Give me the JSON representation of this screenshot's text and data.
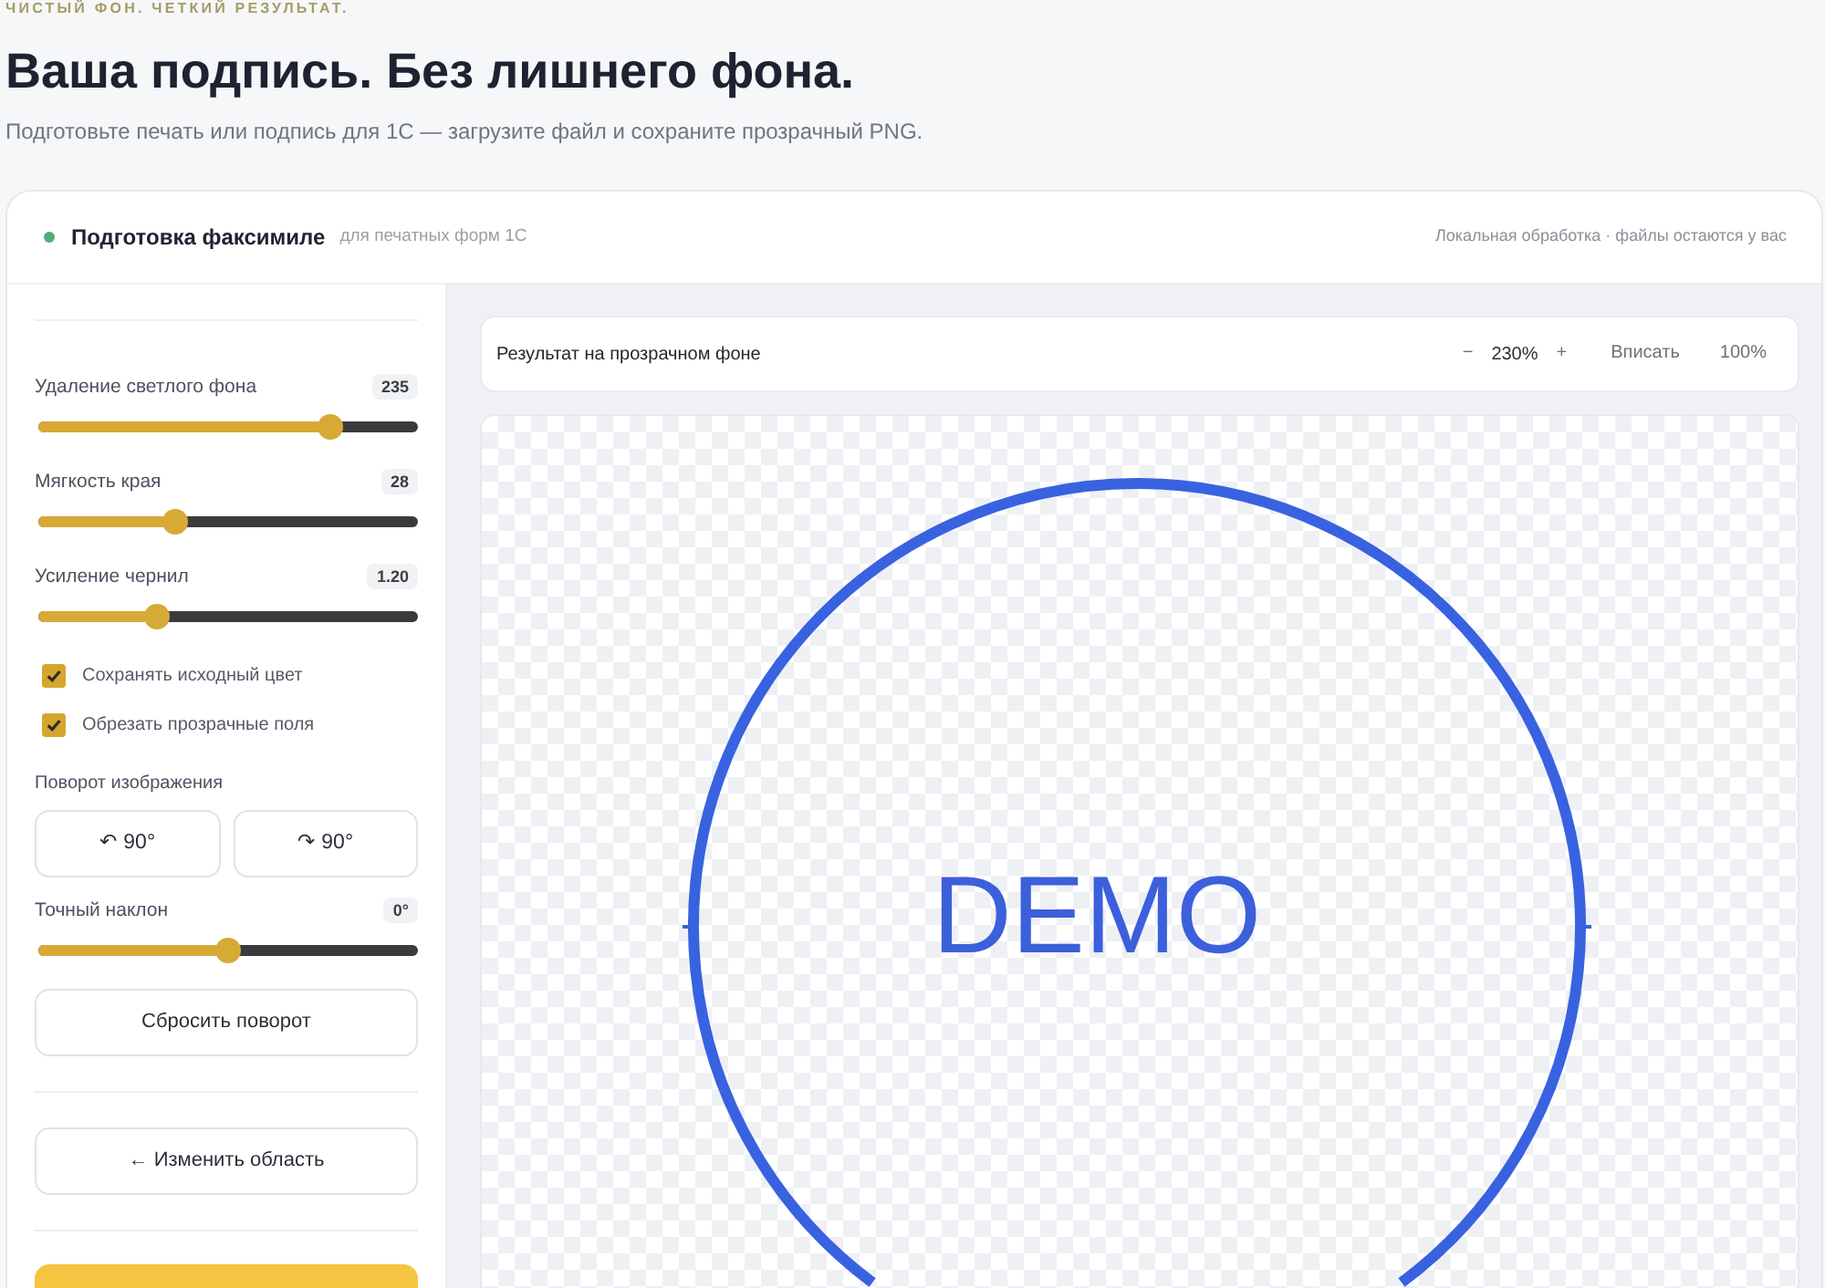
{
  "eyebrow": "ЧИСТЫЙ ФОН. ЧЕТКИЙ РЕЗУЛЬТАТ.",
  "title": "Ваша подпись. Без лишнего фона.",
  "subtitle": "Подготовьте печать или подпись для 1С — загрузите файл и сохраните прозрачный PNG.",
  "card_header": {
    "title": "Подготовка факсимиле",
    "subtitle": "для печатных форм 1С",
    "note": "Локальная обработка · файлы остаются у вас"
  },
  "settings": [
    {
      "kind": "divider"
    },
    {
      "kind": "slider",
      "label": "Удаление светлого фона",
      "value": "235",
      "level": 0.79
    },
    {
      "kind": "slider",
      "label": "Мягкость края",
      "value": "28",
      "level": 0.35
    },
    {
      "kind": "slider",
      "label": "Усиление чернил",
      "value": "1.20",
      "level": 0.3
    },
    {
      "kind": "checkbox",
      "label": "Сохранять исходный цвет",
      "checked": true
    },
    {
      "kind": "checkbox",
      "label": "Обрезать прозрачные поля",
      "checked": true
    },
    {
      "kind": "button_pair",
      "label": "Поворот изображения",
      "buttons": [
        "↶ 90°",
        "↷ 90°"
      ]
    },
    {
      "kind": "slider",
      "label": "Точный наклон",
      "value": "0°",
      "level": 0.5
    },
    {
      "kind": "button",
      "label": "Сбросить поворот"
    },
    {
      "kind": "divider"
    },
    {
      "kind": "button",
      "label": "← Изменить область"
    },
    {
      "kind": "divider"
    },
    {
      "kind": "primary_button"
    }
  ],
  "preview": {
    "toolbar": {
      "title": "Результат на прозрачном фоне",
      "zoom_out": "−",
      "zoom_level": "230%",
      "zoom_in": "+",
      "fit": "Вписать",
      "actual_size": "100%"
    },
    "stamp_text": "DEMO"
  }
}
